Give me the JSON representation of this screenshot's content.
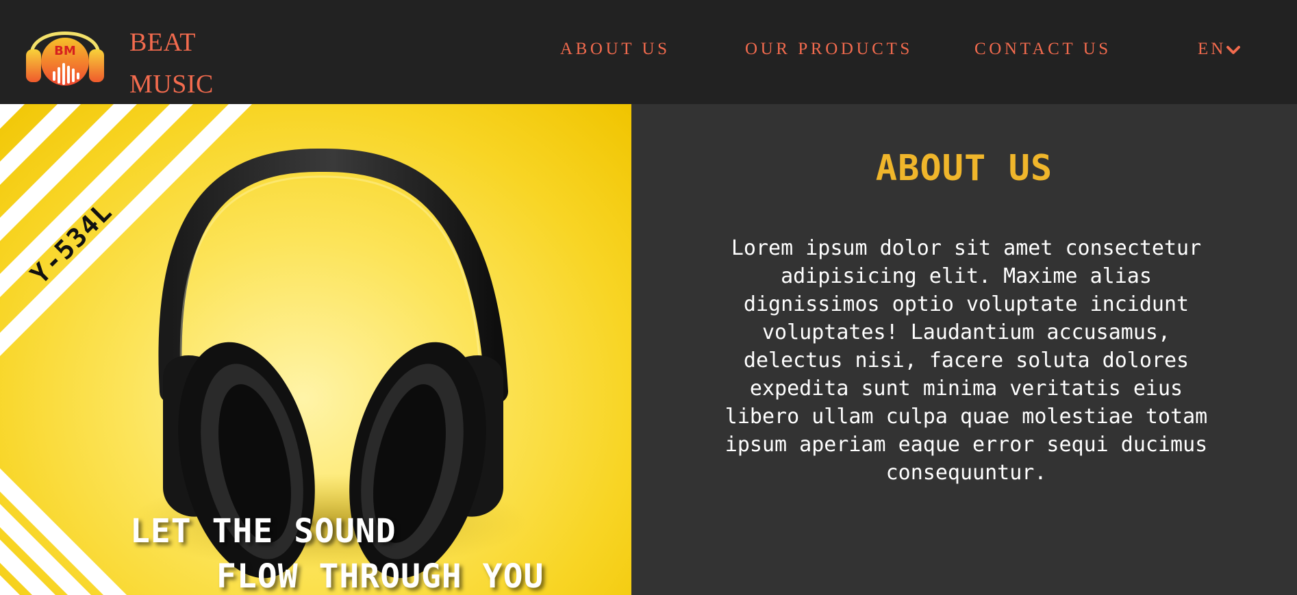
{
  "brand": {
    "logo_name": "beat-music-logo",
    "logo_text": "BM",
    "line1": "BEAT",
    "line2": "MUSIC"
  },
  "nav": {
    "items": [
      {
        "label": "ABOUT US"
      },
      {
        "label": "OUR PRODUCTS"
      },
      {
        "label": "CONTACT US"
      }
    ],
    "language": "EN",
    "language_icon": "chevron-down-icon"
  },
  "hero": {
    "product_tag": "Y-534L",
    "slogan_line1": "LET THE SOUND",
    "slogan_line2": "FLOW THROUGH YOU",
    "image": "headphones-on-yellow-background"
  },
  "about": {
    "title": "ABOUT US",
    "body": "Lorem ipsum dolor sit amet consectetur adipisicing elit. Maxime alias dignissimos optio voluptate incidunt voluptates! Laudantium accusamus, delectus nisi, facere soluta dolores expedita sunt minima veritatis eius libero ullam culpa quae molestiae totam ipsum aperiam eaque error sequi ducimus consequuntur."
  },
  "colors": {
    "header_bg": "#222222",
    "accent_nav": "#f36b4e",
    "about_title": "#f0b62b",
    "about_bg": "#333333",
    "hero_yellow": "#f8d525"
  }
}
